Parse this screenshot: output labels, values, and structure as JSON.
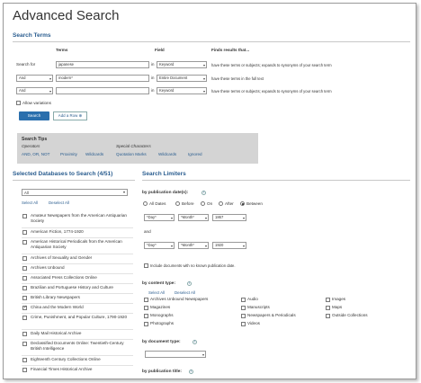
{
  "page": {
    "title": "Advanced Search"
  },
  "search_terms": {
    "heading": "Search Terms",
    "col_terms": "Terms",
    "col_field": "Field",
    "col_results": "Finds results that...",
    "search_for_label": "Search for",
    "in_label": "in",
    "rows": [
      {
        "operator": "",
        "term": "japanese",
        "field": "Keyword",
        "desc": "have these terms or subjects; expands to synonyms of your search term"
      },
      {
        "operator": "And",
        "term": "modern*",
        "field": "Entire Document",
        "desc": "have these terms in the full text"
      },
      {
        "operator": "And",
        "term": "",
        "field": "Keyword",
        "desc": "have these terms or subjects; expands to synonyms of your search term"
      }
    ],
    "allow_variations": "Allow variations",
    "search_button": "Search",
    "add_row_button": "Add a Row"
  },
  "search_tips": {
    "title": "Search Tips",
    "operators_label": "Operators",
    "special_label": "Special Characters",
    "operator_links": [
      "AND, OR, NOT",
      "Proximity",
      "Wildcards"
    ],
    "special_links": [
      "Quotation Marks",
      "Wildcards",
      "Ignored"
    ]
  },
  "databases": {
    "heading": "Selected Databases to Search (4/51)",
    "filter_value": "All",
    "select_all": "Select All",
    "deselect_all": "Deselect All",
    "items": [
      {
        "name": "Amateur Newspapers from the American Antiquarian Society",
        "checked": false
      },
      {
        "name": "American Fiction, 1774-1920",
        "checked": false
      },
      {
        "name": "American Historical Periodicals from the American Antiquarian Society",
        "checked": false
      },
      {
        "name": "Archives of Sexuality and Gender",
        "checked": false
      },
      {
        "name": "Archives Unbound",
        "checked": false
      },
      {
        "name": "Associated Press Collections Online",
        "checked": false
      },
      {
        "name": "Brazilian and Portuguese History and Culture",
        "checked": false
      },
      {
        "name": "British Library Newspapers",
        "checked": false
      },
      {
        "name": "China and the Modern World",
        "checked": true
      },
      {
        "name": "Crime, Punishment, and Popular Culture, 1790-1920",
        "checked": false
      },
      {
        "name": "Daily Mail Historical Archive",
        "checked": false
      },
      {
        "name": "Declassified Documents Online: Twentieth-Century British Intelligence",
        "checked": false
      },
      {
        "name": "Eighteenth Century Collections Online",
        "checked": false
      },
      {
        "name": "Financial Times Historical Archive",
        "checked": false
      }
    ]
  },
  "limiters": {
    "heading": "Search Limiters",
    "by_date_label": "by publication date(s):",
    "date_options": [
      "All Dates",
      "Before",
      "On",
      "After",
      "Between"
    ],
    "selected_date_option": "Between",
    "from": {
      "day": "*Day*",
      "month": "*Month*",
      "year": "1867"
    },
    "and_label": "and",
    "to": {
      "day": "*Day*",
      "month": "*Month*",
      "year": "1920"
    },
    "no_date_label": "Include documents with no known publication date.",
    "by_content_label": "by content type:",
    "select_all": "Select All",
    "deselect_all": "Deselect All",
    "content_types": [
      [
        "Archives Unbound Newspapers",
        "Magazines",
        "Monographs",
        "Photographs"
      ],
      [
        "Audio",
        "Manuscripts",
        "Newspapers & Periodicals",
        "Videos"
      ],
      [
        "Images",
        "Maps",
        "Outside Collections"
      ]
    ],
    "by_doc_label": "by document type:",
    "by_title_label": "by publication title:"
  }
}
